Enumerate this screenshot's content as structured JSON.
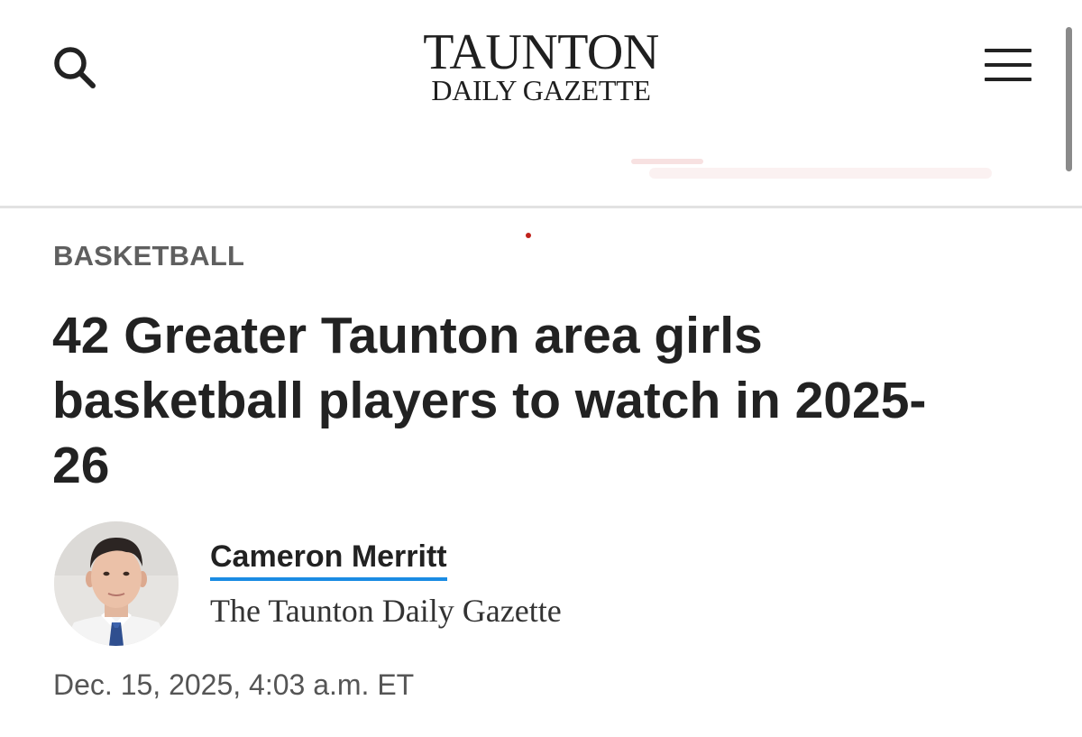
{
  "header": {
    "logo_line1": "TAUNTON",
    "logo_line2": "DAILY GAZETTE",
    "search_icon": "search-icon",
    "menu_icon": "hamburger-menu-icon"
  },
  "article": {
    "category": "BASKETBALL",
    "headline": "42 Greater Taunton area girls basketball players to watch in 2025-26",
    "author": {
      "name": "Cameron Merritt",
      "organization": "The Taunton Daily Gazette"
    },
    "timestamp": "Dec. 15, 2025, 4:03 a.m. ET"
  },
  "colors": {
    "author_underline": "#1a8ce3",
    "category_text": "#5f5f5f",
    "headline_text": "#222222"
  }
}
